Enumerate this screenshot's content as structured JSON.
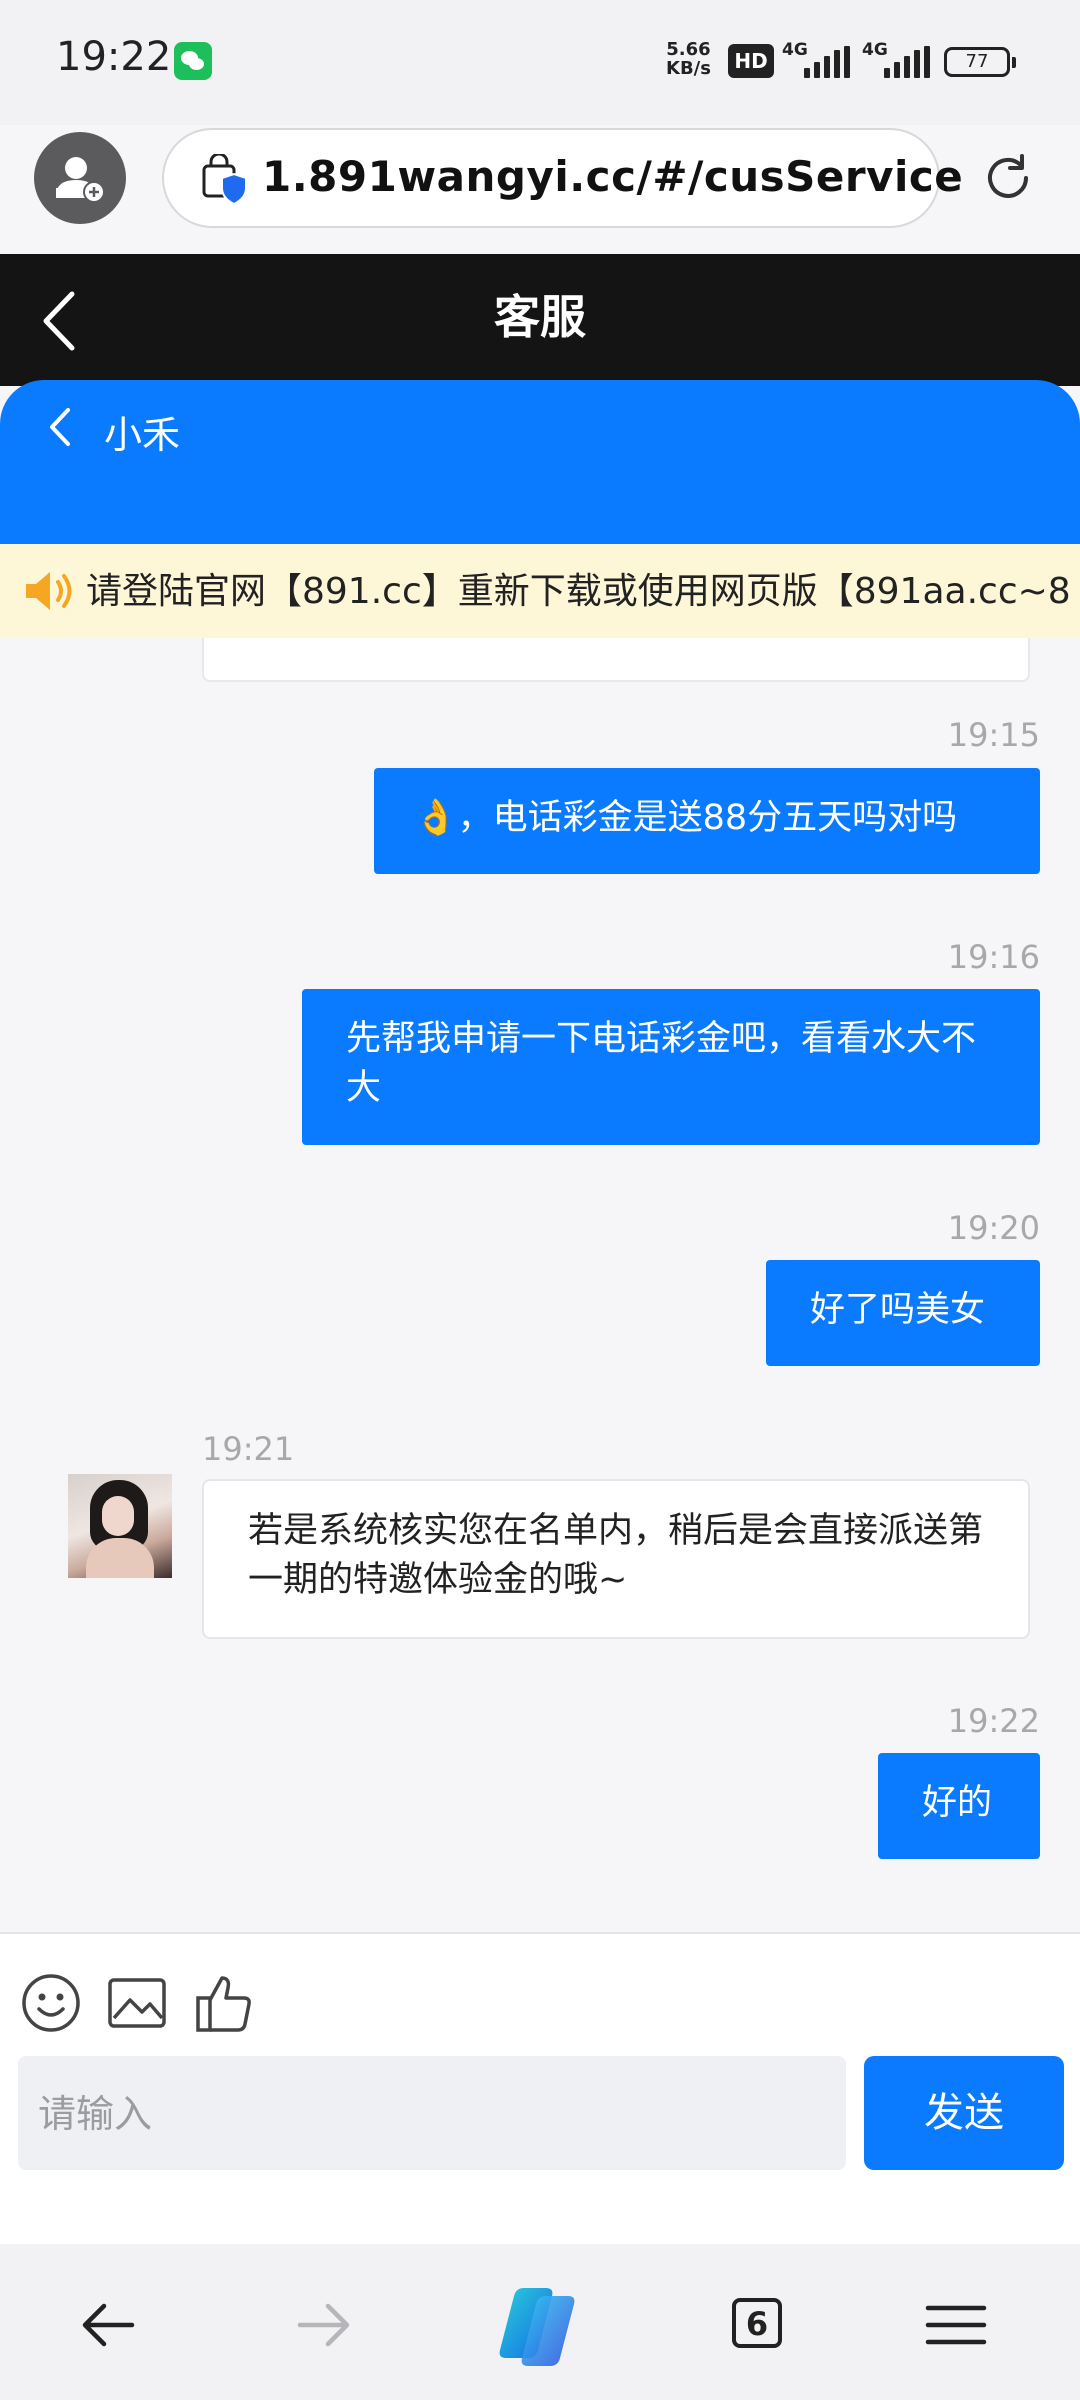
{
  "status_bar": {
    "time": "19:22",
    "net_speed_value": "5.66",
    "net_speed_unit": "KB/s",
    "hd_label": "HD",
    "signal1_label": "4G",
    "signal2_label": "4G",
    "battery": "77"
  },
  "browser": {
    "url": "1.891wangyi.cc/#/cusService"
  },
  "header": {
    "title": "客服"
  },
  "agent": {
    "name": "小禾"
  },
  "notice": {
    "text": "请登陆官网【891.cc】重新下载或使用网页版【891aa.cc~8"
  },
  "messages": [
    {
      "time": "19:15",
      "text": "👌，电话彩金是送88分五天吗对吗",
      "direction": "out"
    },
    {
      "time": "19:16",
      "text": "先帮我申请一下电话彩金吧，看看水大不大",
      "direction": "out"
    },
    {
      "time": "19:20",
      "text": "好了吗美女",
      "direction": "out"
    },
    {
      "time": "19:21",
      "text": "若是系统核实您在名单内，稍后是会直接派送第一期的特邀体验金的哦~",
      "direction": "in"
    },
    {
      "time": "19:22",
      "text": "好的",
      "direction": "out"
    }
  ],
  "input": {
    "placeholder": "请输入",
    "send_label": "发送"
  },
  "bottom_nav": {
    "tab_count": "6"
  },
  "colors": {
    "accent": "#0a7afe",
    "header_bg": "#141414",
    "notice_bg": "#fdf7d8"
  },
  "icons": [
    "back-icon",
    "security-lock-icon",
    "reload-icon",
    "speaker-icon",
    "emoji-icon",
    "image-icon",
    "thumbs-up-icon",
    "nav-back-icon",
    "nav-forward-icon",
    "copilot-icon",
    "menu-icon"
  ]
}
